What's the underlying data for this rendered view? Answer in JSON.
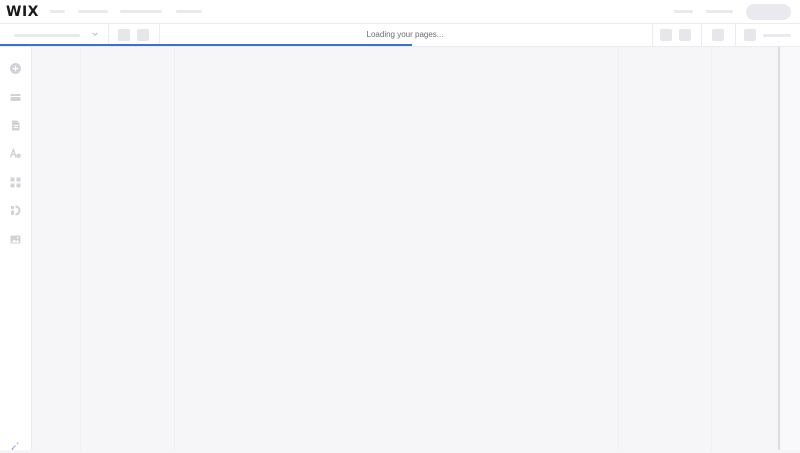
{
  "app": {
    "logo": "WIX"
  },
  "toolbar": {
    "loading_text": "Loading your pages..."
  },
  "progress": {
    "fraction": 0.515,
    "color": "#3b6fd8"
  },
  "sidebar": {
    "icons": [
      "add-icon",
      "sections-icon",
      "pages-icon",
      "design-icon",
      "apps-icon",
      "business-icon",
      "media-icon"
    ]
  },
  "colors": {
    "accent": "#3b6fd8",
    "skeleton": "#e9e9ee"
  }
}
